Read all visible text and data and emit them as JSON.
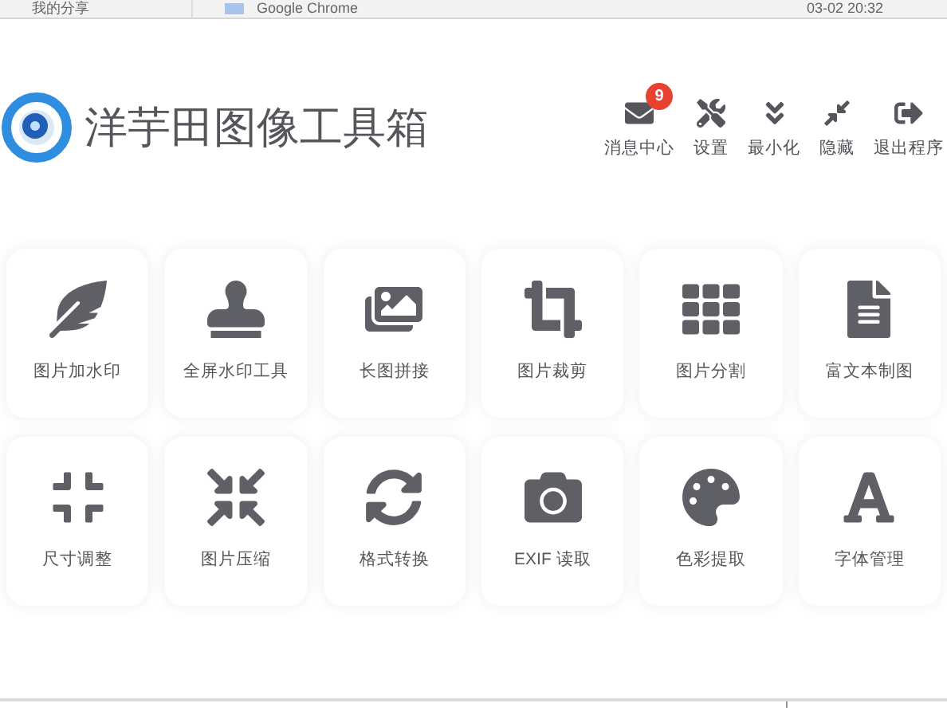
{
  "background_window": {
    "folder": "我的分享",
    "app": "Google Chrome",
    "time": "03-02 20:32"
  },
  "app": {
    "title": "洋芋田图像工具箱"
  },
  "header_actions": [
    {
      "kind": "messages",
      "label": "消息中心",
      "badge": "9"
    },
    {
      "kind": "settings",
      "label": "设置"
    },
    {
      "kind": "minimize",
      "label": "最小化"
    },
    {
      "kind": "hide",
      "label": "隐藏"
    },
    {
      "kind": "exit",
      "label": "退出程序"
    }
  ],
  "tools": [
    {
      "kind": "feather",
      "label": "图片加水印"
    },
    {
      "kind": "stamp",
      "label": "全屏水印工具"
    },
    {
      "kind": "images",
      "label": "长图拼接"
    },
    {
      "kind": "crop",
      "label": "图片裁剪"
    },
    {
      "kind": "grid",
      "label": "图片分割"
    },
    {
      "kind": "document",
      "label": "富文本制图"
    },
    {
      "kind": "shrink",
      "label": "尺寸调整"
    },
    {
      "kind": "compress",
      "label": "图片压缩"
    },
    {
      "kind": "sync",
      "label": "格式转换"
    },
    {
      "kind": "camera",
      "label": "EXIF 读取"
    },
    {
      "kind": "palette",
      "label": "色彩提取"
    },
    {
      "kind": "font",
      "label": "字体管理"
    }
  ]
}
